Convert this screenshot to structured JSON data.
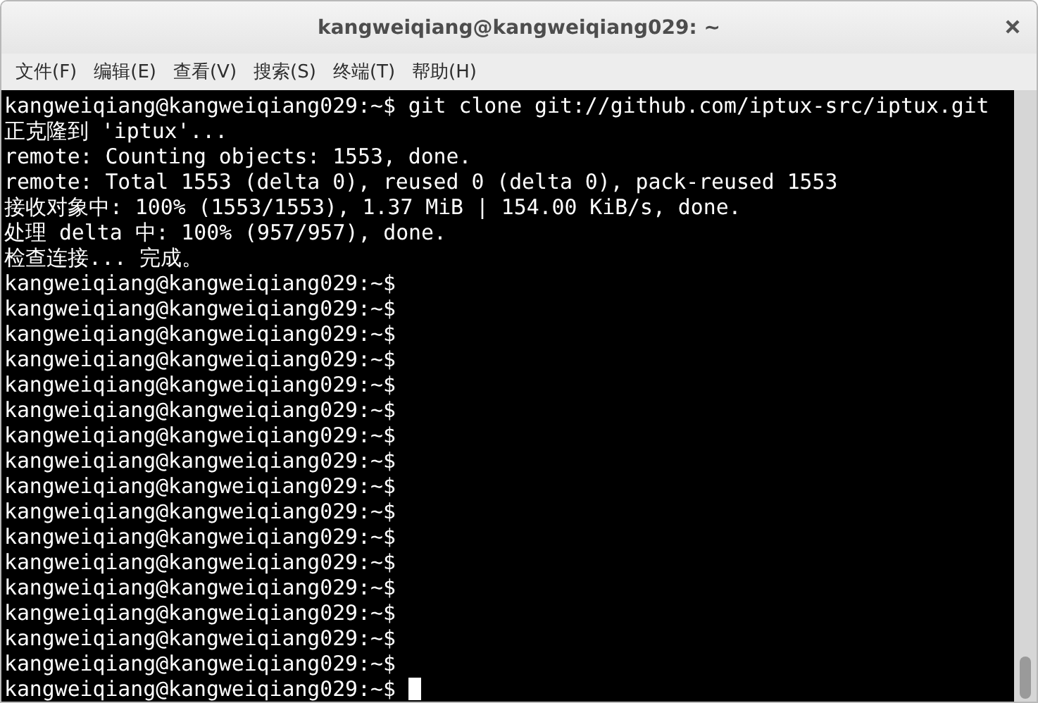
{
  "window": {
    "title": "kangweiqiang@kangweiqiang029: ~"
  },
  "menu": [
    {
      "label": "文件(F)"
    },
    {
      "label": "编辑(E)"
    },
    {
      "label": "查看(V)"
    },
    {
      "label": "搜索(S)"
    },
    {
      "label": "终端(T)"
    },
    {
      "label": "帮助(H)"
    }
  ],
  "terminal": {
    "cursor": true,
    "lines": [
      "kangweiqiang@kangweiqiang029:~$ git clone git://github.com/iptux-src/iptux.git",
      "正克隆到 'iptux'...",
      "remote: Counting objects: 1553, done.",
      "remote: Total 1553 (delta 0), reused 0 (delta 0), pack-reused 1553",
      "接收对象中: 100% (1553/1553), 1.37 MiB | 154.00 KiB/s, done.",
      "处理 delta 中: 100% (957/957), done.",
      "检查连接... 完成。",
      "kangweiqiang@kangweiqiang029:~$",
      "kangweiqiang@kangweiqiang029:~$",
      "kangweiqiang@kangweiqiang029:~$",
      "kangweiqiang@kangweiqiang029:~$",
      "kangweiqiang@kangweiqiang029:~$",
      "kangweiqiang@kangweiqiang029:~$",
      "kangweiqiang@kangweiqiang029:~$",
      "kangweiqiang@kangweiqiang029:~$",
      "kangweiqiang@kangweiqiang029:~$",
      "kangweiqiang@kangweiqiang029:~$",
      "kangweiqiang@kangweiqiang029:~$",
      "kangweiqiang@kangweiqiang029:~$",
      "kangweiqiang@kangweiqiang029:~$",
      "kangweiqiang@kangweiqiang029:~$",
      "kangweiqiang@kangweiqiang029:~$",
      "kangweiqiang@kangweiqiang029:~$",
      "kangweiqiang@kangweiqiang029:~$"
    ]
  }
}
